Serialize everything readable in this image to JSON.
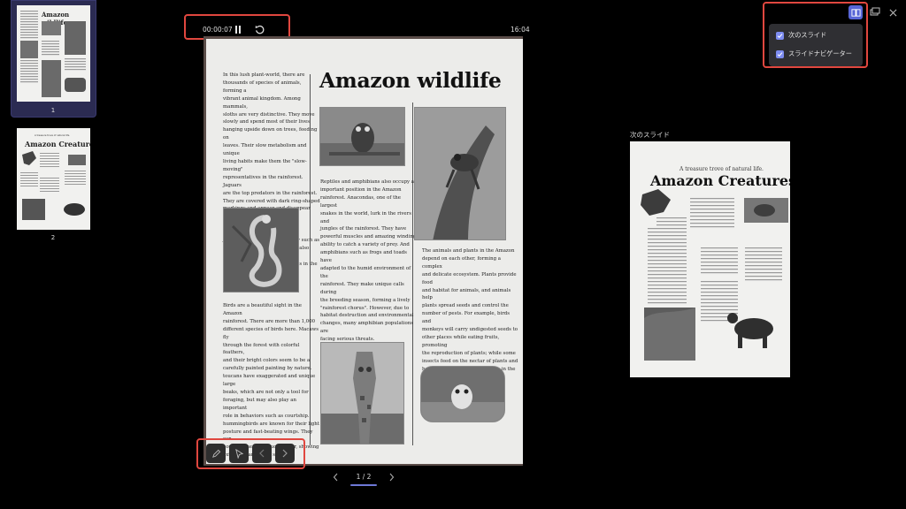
{
  "thumbnails": [
    {
      "number": "1",
      "title": "Amazon wildlife",
      "selected": true
    },
    {
      "number": "2",
      "title": "Amazon Creatures",
      "subtitle": "A treasure trove of natural life.",
      "selected": false
    }
  ],
  "presenter": {
    "elapsed_time": "00:00:07",
    "clock": "16:04",
    "page_indicator": "1 / 2",
    "pause_icon": "pause-icon",
    "reset_icon": "reset-icon"
  },
  "main_slide": {
    "title": "Amazon wildlife",
    "col1_top": "In this lush plant-world, there are\nthousands of species of animals, forming a\nvibrant animal kingdom. Among mammals,\nsloths are very distinctive. They move\nslowly and spend most of their lives\nhanging upside down on trees, feeding on\nleaves. Their slow metabolism and unique\nliving habits make them the \"slow-moving\"\nrepresentatives in the rainforest. Jaguars\nare the top predators in the rainforest.\nThey are covered with dark ring-shaped\nmarkings and appear and disappear like\nghosts in the jungle. As good swimmers,\njaguars can not only chase prey such as\ndeer and monkeys on land, but also catch\nfish, turtles and small crocodiles in the\nwater.",
    "col1_bottom": "Birds are a beautiful sight in the Amazon\nrainforest. There are more than 1,000\ndifferent species of birds here. Macaws fly\nthrough the forest with colorful feathers,\nand their bright colors seem to be a\ncarefully painted painting by nature.\ntoucans have exaggerated and unique large\nbeaks, which are not only a tool for\nforaging, but may also play an important\nrole in behaviors such as courtship.\nhummingbirds are known for their light\nposture and fast-beating wings. They can\nhover in the air to suck nectar, showing\nextraordinary flying skills.",
    "col2_text": "Reptiles and amphibians also occupy an\nimportant position in the Amazon\nrainforest. Anacondas, one of the largest\nsnakes in the world, lurk in the rivers and\njungles of the rainforest. They have\npowerful muscles and amazing winding\nability to catch a variety of prey. And\namphibians such as frogs and toads have\nadapted to the humid environment of the\nrainforest. They make unique calls during\nthe breeding season, forming a lively\n\"rainforest chorus\". However, due to\nhabitat destruction and environmental\nchanges, many amphibian populations are\nfacing serious threats.",
    "col3_text": "The animals and plants in the Amazon\ndepend on each other, forming a complex\nand delicate ecosystem. Plants provide food\nand habitat for animals, and animals help\nplants spread seeds and control the\nnumber of pests. For example, birds and\nmonkeys will carry undigested seeds to\nother places while eating fruits, promoting\nthe reproduction of plants; while some\ninsects feed on the nectar of plants and\nhelp plants complete pollination in the\nprocess of collecting nectar"
  },
  "next_slide": {
    "label": "次のスライド",
    "title": "Amazon Creatures",
    "subtitle": "A treasure trove of natural life."
  },
  "settings_menu": {
    "items": [
      {
        "label": "次のスライド",
        "checked": true
      },
      {
        "label": "スライドナビゲーター",
        "checked": true
      }
    ]
  },
  "toolbar": {
    "pen_icon": "pen-icon",
    "pointer_icon": "pointer-icon",
    "prev_icon": "chevron-left-icon",
    "next_icon": "chevron-right-icon"
  },
  "colors": {
    "highlight": "#e0473f",
    "accent": "#7d8cf0",
    "selected_thumb": "#2b2b52"
  }
}
